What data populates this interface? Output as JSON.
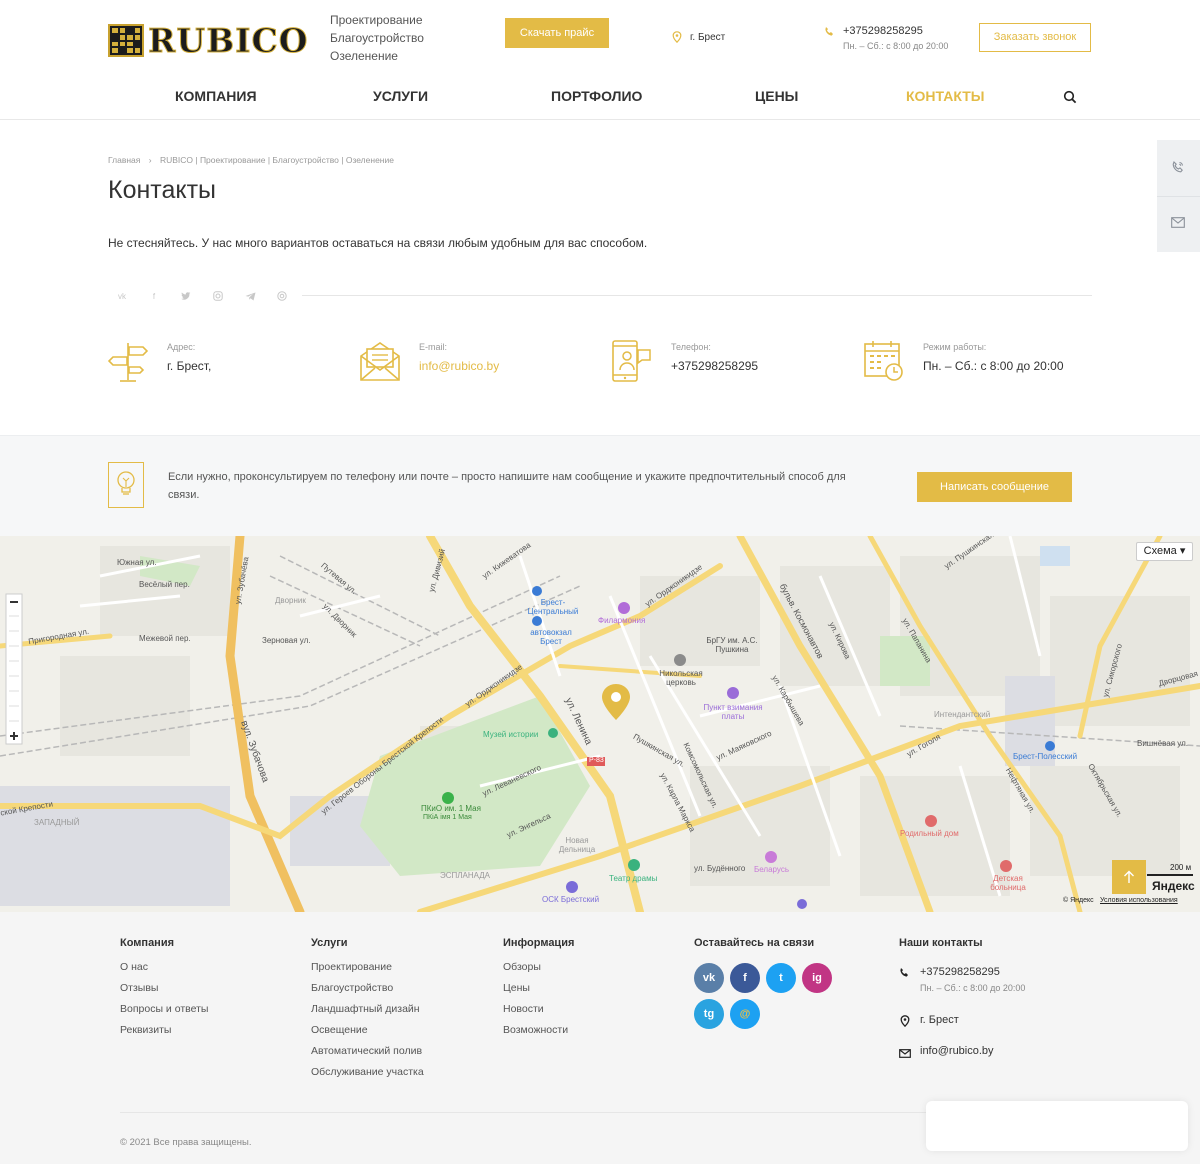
{
  "header": {
    "logo_text": "RUBICO",
    "slogan": [
      "Проектирование",
      "Благоустройство",
      "Озеленение"
    ],
    "price_button": "Скачать прайс",
    "city": "г. Брест",
    "phone": "+375298258295",
    "hours": "Пн. – Сб.: с 8:00 до 20:00",
    "call_button": "Заказать звонок"
  },
  "nav": {
    "items": [
      "КОМПАНИЯ",
      "УСЛУГИ",
      "ПОРТФОЛИО",
      "ЦЕНЫ",
      "КОНТАКТЫ"
    ],
    "active": "КОНТАКТЫ"
  },
  "breadcrumb": [
    "Главная",
    "›",
    "RUBICO | Проектирование | Благоустройство | Озеленение"
  ],
  "page": {
    "title": "Контакты",
    "intro": "Не стесняйтесь. У нас много вариантов оставаться на связи любым удобным для вас способом."
  },
  "social_icons": [
    "vk-icon",
    "facebook-icon",
    "twitter-icon",
    "instagram-icon",
    "telegram-icon",
    "email-icon"
  ],
  "contacts": [
    {
      "label": "Адрес:",
      "value": "г. Брест,",
      "icon": "signpost-icon"
    },
    {
      "label": "E-mail:",
      "value": "info@rubico.by",
      "icon": "mail-icon"
    },
    {
      "label": "Телефон:",
      "value": "+375298258295",
      "icon": "phone-icon"
    },
    {
      "label": "Режим работы:",
      "value": "Пн. – Сб.: с 8:00 до 20:00",
      "icon": "calendar-icon"
    }
  ],
  "consult": {
    "text": "Если нужно, проконсультируем по телефону или почте – просто напишите нам сообщение и укажите предпочтительный способ для связи.",
    "button": "Написать сообщение"
  },
  "map": {
    "type_button": "Схема ▾",
    "scale": "200 м",
    "brand": "Яндекс",
    "copyright": "© Яндекс",
    "terms": "Условия использования",
    "labels": [
      "Южная ул.",
      "Весёлый пер.",
      "Пригородная ул.",
      "Межевой пер.",
      "Дворник",
      "Зерновая ул.",
      "Путевая ул.",
      "ул. Дворник",
      "ул. Зубачёва",
      "вул. Зубачова",
      "Брест-Центральный",
      "автовокзал Брест",
      "Филармония",
      "ул. Орджоникидзе",
      "ул. Кижеватова",
      "ул. Дивизий",
      "БрГУ им. А.С. Пушкина",
      "Никольская церковь",
      "Пункт взимания платы",
      "Музей истории",
      "ул. Ленина",
      "Пушкинская ул.",
      "ул. Маяковского",
      "Комсомольская ул.",
      "ул. Карла Маркса",
      "ПКиО им. 1 Мая",
      "ПКіА імя 1 Мая",
      "ул. Левaневского",
      "ул. Энгельса",
      "Новая Дельница",
      "ЭСПЛАНАДА",
      "ЗАПАДНЫЙ",
      "Театр драмы",
      "ОСК Брестский",
      "ул. Будённого",
      "Беларусь",
      "бульв. Космонавтов",
      "ул. Гоголя",
      "Родильный дом",
      "Интендантский",
      "Брест-Полесский",
      "Детская больница",
      "Нефтяная ул.",
      "ул. Сикорского",
      "Дворцовая",
      "Вишнёвая ул.",
      "ул. Пушкинская",
      "ул. Папанина",
      "ул. Кирова",
      "ул. Карбышева",
      "Октябрьская ул.",
      "ул. Героев Обороны Брестской Крепости",
      "ул. Орджоникидзе",
      "Р-83",
      "ской Крепости"
    ]
  },
  "footer": {
    "columns": [
      {
        "title": "Компания",
        "items": [
          "О нас",
          "Отзывы",
          "Вопросы и ответы",
          "Реквизиты"
        ]
      },
      {
        "title": "Услуги",
        "items": [
          "Проектирование",
          "Благоустройство",
          "Ландшафтный дизайн",
          "Освещение",
          "Автоматический полив",
          "Обслуживание участка"
        ]
      },
      {
        "title": "Информация",
        "items": [
          "Обзоры",
          "Цены",
          "Новости",
          "Возможности"
        ]
      }
    ],
    "social_title": "Оставайтесь на связи",
    "social_buttons": [
      {
        "label": "vk",
        "color": "#5a7fa8"
      },
      {
        "label": "f",
        "color": "#3b5998"
      },
      {
        "label": "t",
        "color": "#1da1f2"
      },
      {
        "label": "ig",
        "color": "#c13584"
      },
      {
        "label": "tg",
        "color": "#2aa3e0"
      },
      {
        "label": "@",
        "color": "#1da1f2"
      }
    ],
    "contacts_title": "Наши контакты",
    "phone": "+375298258295",
    "hours": "Пн. – Сб.: с 8:00 до 20:00",
    "city": "г. Брест",
    "email": "info@rubico.by",
    "copyright": "© 2021 Все права защищены."
  },
  "colors": {
    "accent": "#e3bb46",
    "text": "#333333",
    "footer_bg": "#f5f5f5"
  }
}
